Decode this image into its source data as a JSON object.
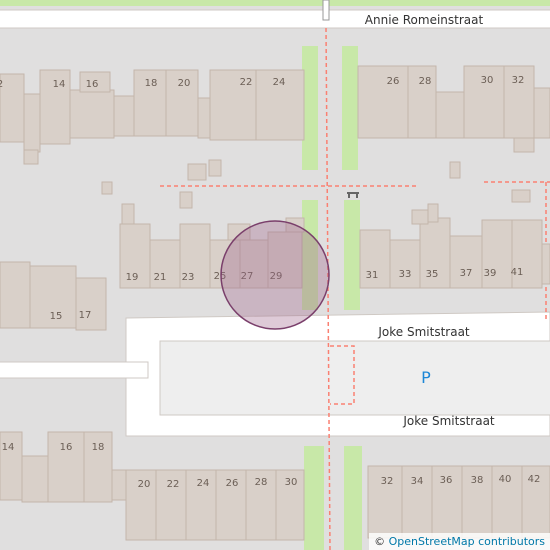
{
  "map": {
    "streets": [
      {
        "name": "Annie Romeinstraat"
      },
      {
        "name": "Joke Smitstraat"
      },
      {
        "name": "Joke Smitstraat"
      }
    ],
    "parking_label": "P",
    "attribution": {
      "symbol": "©",
      "text": "OpenStreetMap contributors"
    },
    "house_numbers": [
      "2",
      "14",
      "16",
      "18",
      "20",
      "22",
      "24",
      "26",
      "28",
      "30",
      "32",
      "19",
      "21",
      "23",
      "25",
      "27",
      "29",
      "31",
      "33",
      "35",
      "37",
      "39",
      "41",
      "15",
      "17",
      "14",
      "16",
      "18",
      "20",
      "22",
      "24",
      "26",
      "28",
      "30",
      "32",
      "34",
      "36",
      "38",
      "40",
      "42"
    ],
    "highlight_circle": {
      "fill": "#a0668c",
      "stroke": "#7a3f6b"
    },
    "colors": {
      "building": "#d9d0c9",
      "road": "#ffffff",
      "green": "#c8e8a8",
      "footpath": "#fa8072",
      "parking": "#1d87d6"
    }
  }
}
